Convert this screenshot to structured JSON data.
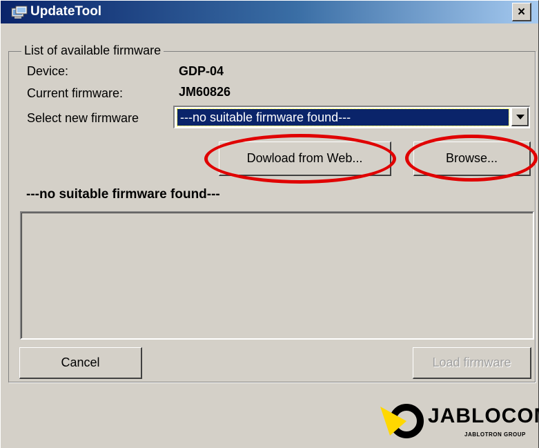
{
  "window": {
    "title": "UpdateTool",
    "close_glyph": "×"
  },
  "group": {
    "title": "List of available firmware"
  },
  "device": {
    "label": "Device:",
    "value": "GDP-04"
  },
  "current_firmware": {
    "label": "Current firmware:",
    "value": "JM60826"
  },
  "select_firmware": {
    "label": "Select new firmware",
    "selected": "---no suitable firmware found---"
  },
  "buttons": {
    "download": "Dowload from Web...",
    "browse": "Browse...",
    "cancel": "Cancel",
    "load": "Load firmware"
  },
  "status_text": "---no suitable firmware found---",
  "logo": {
    "name": "JABLOCOM",
    "sub": "JABLOTRON GROUP"
  },
  "icons": [
    "app-icon",
    "close-icon",
    "dropdown-arrow-icon",
    "jablocom-logo-icon"
  ],
  "colors": {
    "title_bar_start": "#0a246a",
    "title_bar_end": "#a6caf0",
    "window_face": "#d4d0c8",
    "selection": "#0a246a",
    "highlight_ellipse": "#e00000",
    "logo_accent": "#ffd800"
  }
}
